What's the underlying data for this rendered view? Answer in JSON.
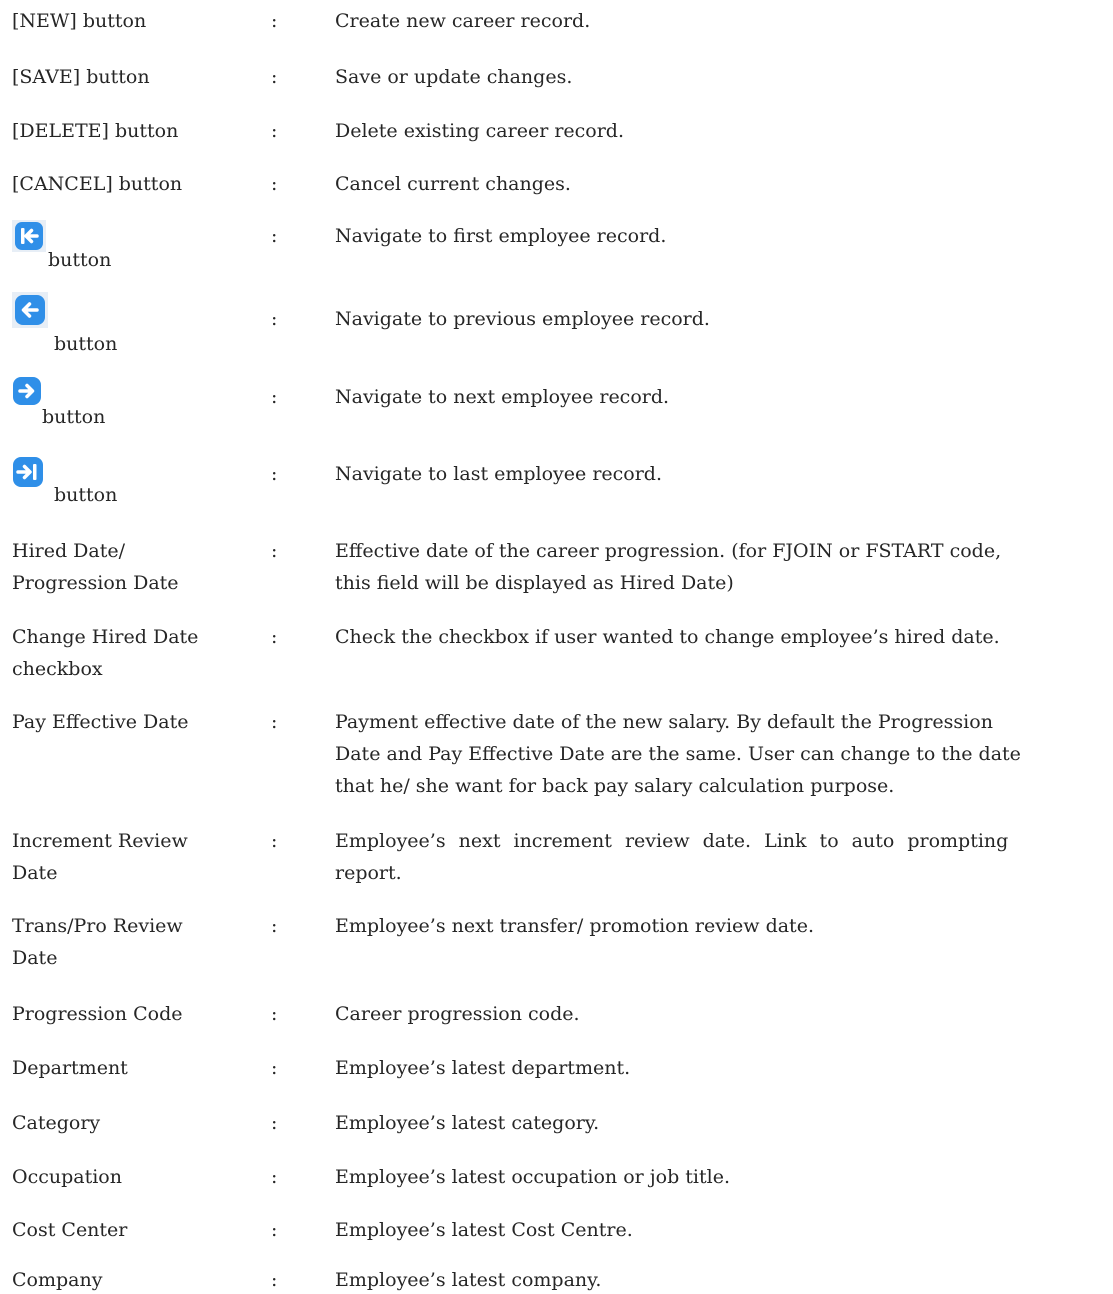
{
  "rows": [
    {
      "term": "[NEW] button",
      "colon": ":",
      "desc": "Create new career record."
    },
    {
      "term": "[SAVE] button",
      "colon": ":",
      "desc": "Save or update changes."
    },
    {
      "term": "[DELETE] button",
      "colon": ":",
      "desc": "Delete existing career record."
    },
    {
      "term": "[CANCEL] button",
      "colon": ":",
      "desc": "Cancel current changes."
    },
    {
      "icon": "first-record-icon",
      "term": "button",
      "colon": ":",
      "desc": "Navigate to first employee record."
    },
    {
      "icon": "previous-record-icon",
      "term": "button",
      "colon": ":",
      "desc": "Navigate to previous employee record."
    },
    {
      "icon": "next-record-icon",
      "term": "button",
      "colon": ":",
      "desc": "Navigate to next employee record."
    },
    {
      "icon": "last-record-icon",
      "term": "button",
      "colon": ":",
      "desc": "Navigate to last employee record."
    },
    {
      "term_lines": [
        "Hired Date/",
        "Progression Date"
      ],
      "colon": ":",
      "desc_lines": [
        "Effective date of the career progression. (for FJOIN or FSTART code,",
        "this field will be displayed as Hired Date)"
      ]
    },
    {
      "term_lines": [
        "Change Hired Date",
        "checkbox"
      ],
      "colon": ":",
      "desc": "Check the checkbox if user wanted to change employee’s hired date."
    },
    {
      "term": "Pay Effective Date",
      "colon": ":",
      "desc_lines": [
        "Payment effective date of the new salary. By default the Progression",
        "Date and Pay Effective Date are the same. User can change to the date",
        "that he/ she want for back pay salary calculation purpose."
      ]
    },
    {
      "term_lines": [
        "Increment Review",
        "Date"
      ],
      "colon": ":",
      "desc_lines": [
        "Employee’s next increment review date. Link to auto prompting",
        "report."
      ]
    },
    {
      "term_lines": [
        "Trans/Pro Review",
        "Date"
      ],
      "colon": ":",
      "desc": "Employee’s next transfer/ promotion review date."
    },
    {
      "term": "Progression Code",
      "colon": ":",
      "desc": "Career progression code."
    },
    {
      "term": "Department",
      "colon": ":",
      "desc": "Employee’s latest department."
    },
    {
      "term": "Category",
      "colon": ":",
      "desc": "Employee’s latest category."
    },
    {
      "term": "Occupation",
      "colon": ":",
      "desc": "Employee’s latest occupation or job title."
    },
    {
      "term": "Cost Center",
      "colon": ":",
      "desc": "Employee’s latest Cost Centre."
    },
    {
      "term": "Company",
      "colon": ":",
      "desc": "Employee’s latest company."
    }
  ],
  "colors": {
    "text": "#262626",
    "icon_blue": "#2f8fe8",
    "icon_bg": "#e7eef6"
  }
}
